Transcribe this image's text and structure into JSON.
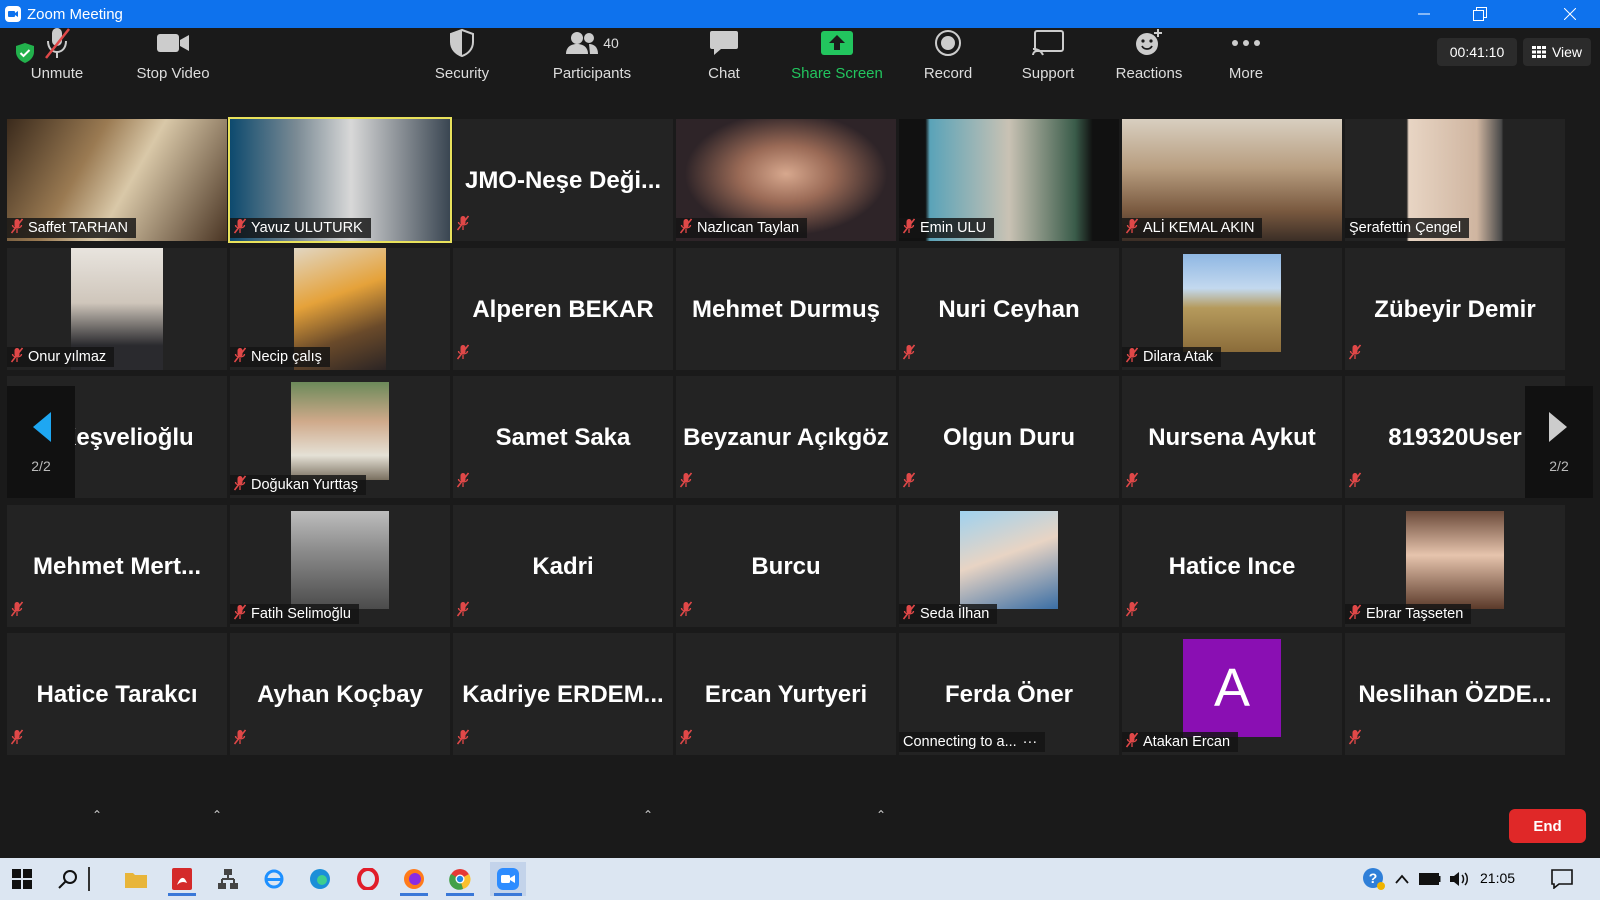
{
  "window": {
    "title": "Zoom Meeting"
  },
  "meeting": {
    "timer": "00:41:10",
    "view_label": "View"
  },
  "colors": {
    "titlebar": "#0e72ed",
    "tile_bg": "#232323",
    "active_speaker": "#e9e25c",
    "end": "#e02828",
    "share": "#22c55e",
    "mute_icon": "#e04848",
    "avatar_a": "#8a0fb3"
  },
  "tiles": [
    {
      "name": "Saffet TARHAN",
      "kind": "video"
    },
    {
      "name": "Yavuz ULUTURK",
      "kind": "video",
      "active": true
    },
    {
      "name": "JMO-Neşe  Deği...",
      "kind": "text"
    },
    {
      "name": "Nazlıcan Taylan",
      "kind": "video"
    },
    {
      "name": "Emin ULU",
      "kind": "video"
    },
    {
      "name": "ALİ KEMAL AKIN",
      "kind": "video"
    },
    {
      "name": "Şerafettin Çengel",
      "kind": "video",
      "muted": false
    },
    {
      "name": "Onur yılmaz",
      "kind": "photo"
    },
    {
      "name": "Necip çalış",
      "kind": "photo"
    },
    {
      "name": "Alperen BEKAR",
      "kind": "text"
    },
    {
      "name": "Mehmet Durmuş",
      "kind": "text",
      "muted": false
    },
    {
      "name": "Nuri Ceyhan",
      "kind": "text"
    },
    {
      "name": "Dilara Atak",
      "kind": "photo"
    },
    {
      "name": "Zübeyir Demir",
      "kind": "text"
    },
    {
      "name": "z Keşvelioğlu",
      "kind": "text"
    },
    {
      "name": "Doğukan Yurttaş",
      "kind": "photo"
    },
    {
      "name": "Samet Saka",
      "kind": "text"
    },
    {
      "name": "Beyzanur Açıkgöz",
      "kind": "text"
    },
    {
      "name": "Olgun Duru",
      "kind": "text"
    },
    {
      "name": "Nursena Aykut",
      "kind": "text"
    },
    {
      "name": "819320User",
      "kind": "text"
    },
    {
      "name": "Mehmet  Mert...",
      "kind": "text"
    },
    {
      "name": "Fatih Selimoğlu",
      "kind": "photo"
    },
    {
      "name": "Kadri",
      "kind": "text"
    },
    {
      "name": "Burcu",
      "kind": "text"
    },
    {
      "name": "Seda İlhan",
      "kind": "photo"
    },
    {
      "name": "Hatice Ince",
      "kind": "text"
    },
    {
      "name": "Ebrar Taşseten",
      "kind": "photo"
    },
    {
      "name": "Hatice Tarakcı",
      "kind": "text"
    },
    {
      "name": "Ayhan Koçbay",
      "kind": "text"
    },
    {
      "name": "Kadriye  ERDEM...",
      "kind": "text"
    },
    {
      "name": "Ercan Yurtyeri",
      "kind": "text"
    },
    {
      "name": "Ferda Öner",
      "kind": "text",
      "status": "Connecting to a..."
    },
    {
      "name": "Atakan Ercan",
      "kind": "avatar",
      "avatar_letter": "A"
    },
    {
      "name": "Neslihan  ÖZDE...",
      "kind": "text"
    }
  ],
  "pager": {
    "left": "2/2",
    "right": "2/2"
  },
  "toolbar": {
    "unmute": "Unmute",
    "stop_video": "Stop Video",
    "security": "Security",
    "participants": "Participants",
    "participants_count": "40",
    "chat": "Chat",
    "share_screen": "Share Screen",
    "record": "Record",
    "support": "Support",
    "reactions": "Reactions",
    "more": "More",
    "end": "End"
  },
  "taskbar": {
    "time": "21:05"
  }
}
